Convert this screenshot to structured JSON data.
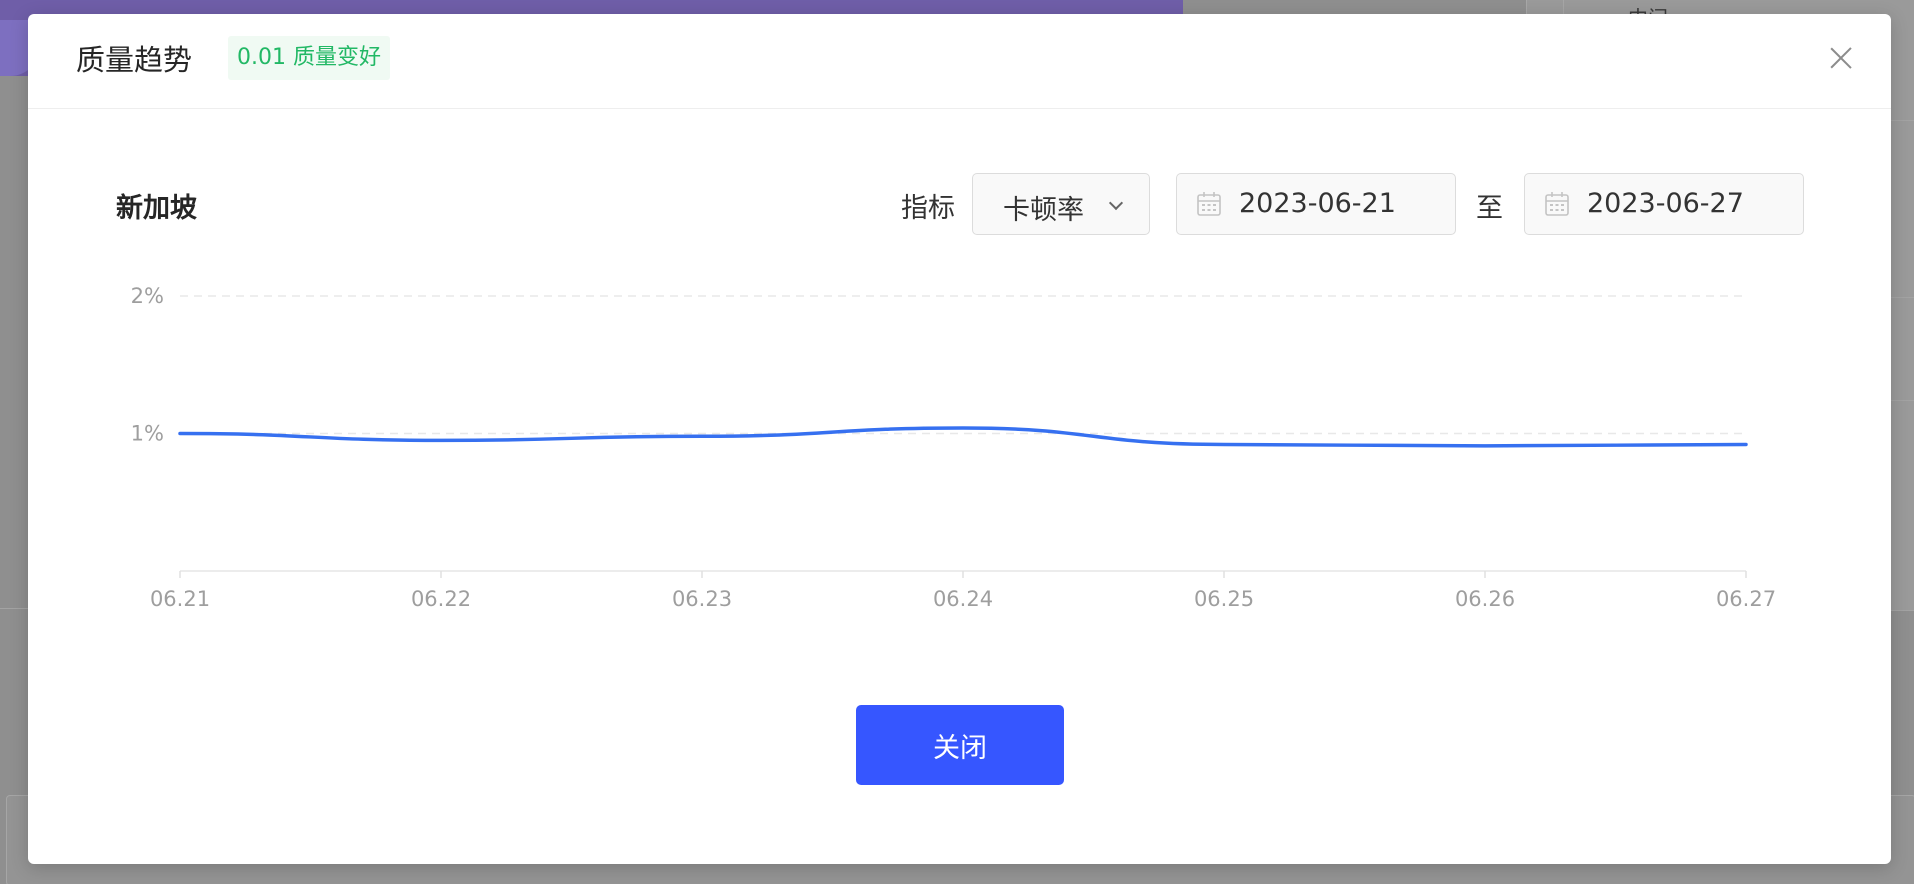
{
  "background": {
    "right_panel_text": "中间"
  },
  "modal": {
    "title": "质量趋势",
    "trend_badge": "0.01 质量变好",
    "close_button": "关闭"
  },
  "filters": {
    "region": "新加坡",
    "metric_label": "指标",
    "metric_value": "卡顿率",
    "start_date": "2023-06-21",
    "to_label": "至",
    "end_date": "2023-06-27"
  },
  "colors": {
    "primary": "#3656ff",
    "line": "#3670f0",
    "trend_good": "#22b865"
  },
  "chart_data": {
    "type": "line",
    "categories": [
      "06.21",
      "06.22",
      "06.23",
      "06.24",
      "06.25",
      "06.26",
      "06.27"
    ],
    "series": [
      {
        "values": [
          1.0,
          0.95,
          0.98,
          1.04,
          0.92,
          0.91,
          0.92
        ]
      }
    ],
    "y_ticks": [
      "2%",
      "1%"
    ],
    "ylim": [
      0,
      2
    ],
    "grid": true
  }
}
